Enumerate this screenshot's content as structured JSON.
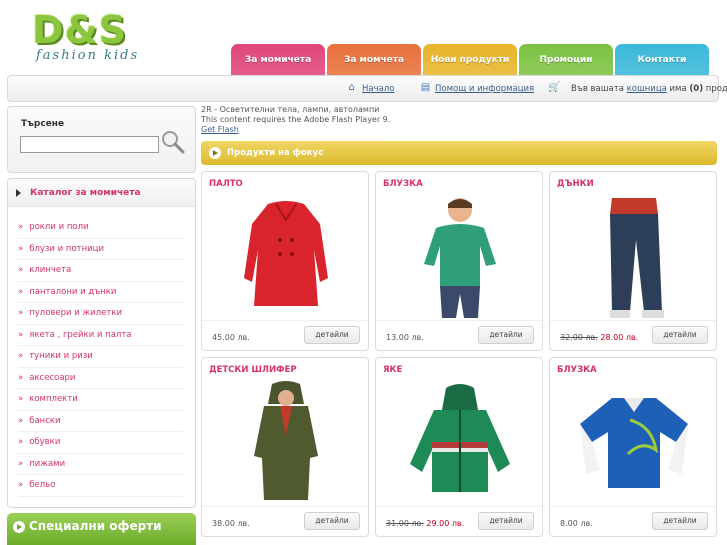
{
  "brand": {
    "logo_text": "D&S",
    "tagline": "fashion kids"
  },
  "tabs": [
    {
      "label": "За момичета",
      "color": "#e0457b"
    },
    {
      "label": "За момчета",
      "color": "#e8703a"
    },
    {
      "label": "Нови продукти",
      "color": "#e7b52a"
    },
    {
      "label": "Промоции",
      "color": "#7cc242"
    },
    {
      "label": "Контакти",
      "color": "#3bb8d9"
    }
  ],
  "topbar": {
    "home": "Начало",
    "help": "Помощ и информация",
    "cart_prefix": "Във вашата",
    "cart_link": "кошница",
    "cart_mid": "има",
    "cart_count": "(0)",
    "cart_suffix": "продукта"
  },
  "search": {
    "label": "Търсене",
    "placeholder": ""
  },
  "catalog": {
    "title": "Каталог за момичета",
    "items": [
      "рокли и поли",
      "блузи и потници",
      "клинчета",
      "панталони и дънки",
      "пуловери и жилетки",
      "якета , грейки и палта",
      "туники и ризи",
      "аксесоари",
      "комплекти",
      "бански",
      "обувки",
      "пижами",
      "бельо"
    ]
  },
  "special_offers": {
    "title": "Специални оферти"
  },
  "flash": {
    "line1": "2R - Осветителни тела, лампи, автолампи",
    "line2": "This content requires the Adobe Flash Player 9.",
    "link": "Get Flash"
  },
  "focus": {
    "title": "Продукти на фокус"
  },
  "products": [
    {
      "name": "ПАЛТО",
      "price": "45.00 лв.",
      "old_price": "",
      "new_price": "",
      "button": "детайли",
      "color": "#d9232d"
    },
    {
      "name": "БЛУЗКА",
      "price": "13.00 лв.",
      "old_price": "",
      "new_price": "",
      "button": "детайли",
      "color": "#2f9e7a"
    },
    {
      "name": "ДЪНКИ",
      "price": "",
      "old_price": "32.00 лв.",
      "new_price": "28.00 лв.",
      "button": "детайли",
      "color": "#2c3e58"
    },
    {
      "name": "ДЕТСКИ ШЛИФЕР",
      "price": "38.00 лв.",
      "old_price": "",
      "new_price": "",
      "button": "детайли",
      "color": "#4f5a2e"
    },
    {
      "name": "ЯКЕ",
      "price": "",
      "old_price": "31.00 лв.",
      "new_price": "29.00 лв.",
      "button": "детайли",
      "color": "#1e8a56"
    },
    {
      "name": "БЛУЗКА",
      "price": "8.00 лв.",
      "old_price": "",
      "new_price": "",
      "button": "детайли",
      "color": "#1e5fb8"
    }
  ]
}
